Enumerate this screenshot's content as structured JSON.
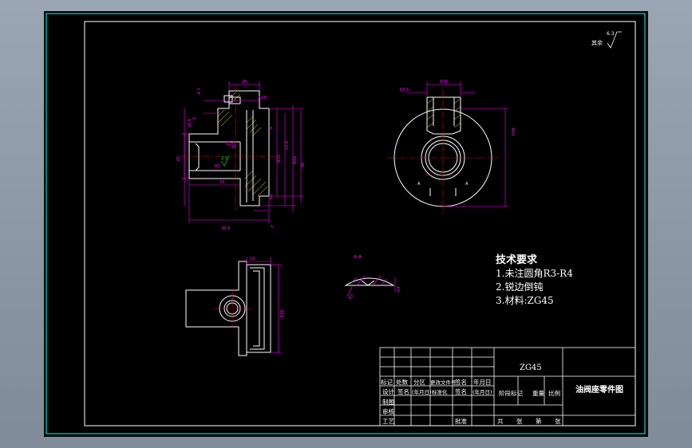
{
  "colors": {
    "background": "#000000",
    "outline": "#ffffff",
    "border": "#00ffff",
    "dimension": "#ff00ff",
    "center_line": "#ff0000",
    "hatch": "#ffff00",
    "surface_symbol": "#00ff00"
  },
  "roughness_note": "其余",
  "tech_requirements": {
    "title": "技术要求",
    "items": [
      "1.未注圆角R3-R4",
      "2.锐边倒钝",
      "3.材料:ZG45"
    ]
  },
  "section_label": "A-A",
  "title_block": {
    "material": "ZG45",
    "part_name": "油阀座零件图",
    "headers": [
      "标记",
      "处数",
      "分区",
      "更改文件号",
      "签名",
      "年月日"
    ],
    "row2": [
      "设计",
      "签名",
      "(年月日)",
      "标准化",
      "签名",
      "(年月日)"
    ],
    "stage_headers": [
      "阶段标记",
      "重量",
      "比例"
    ],
    "roles": [
      "制图",
      "审核",
      "工艺"
    ],
    "approve": "批准",
    "sheet": [
      "共",
      "张",
      "第",
      "张"
    ]
  }
}
